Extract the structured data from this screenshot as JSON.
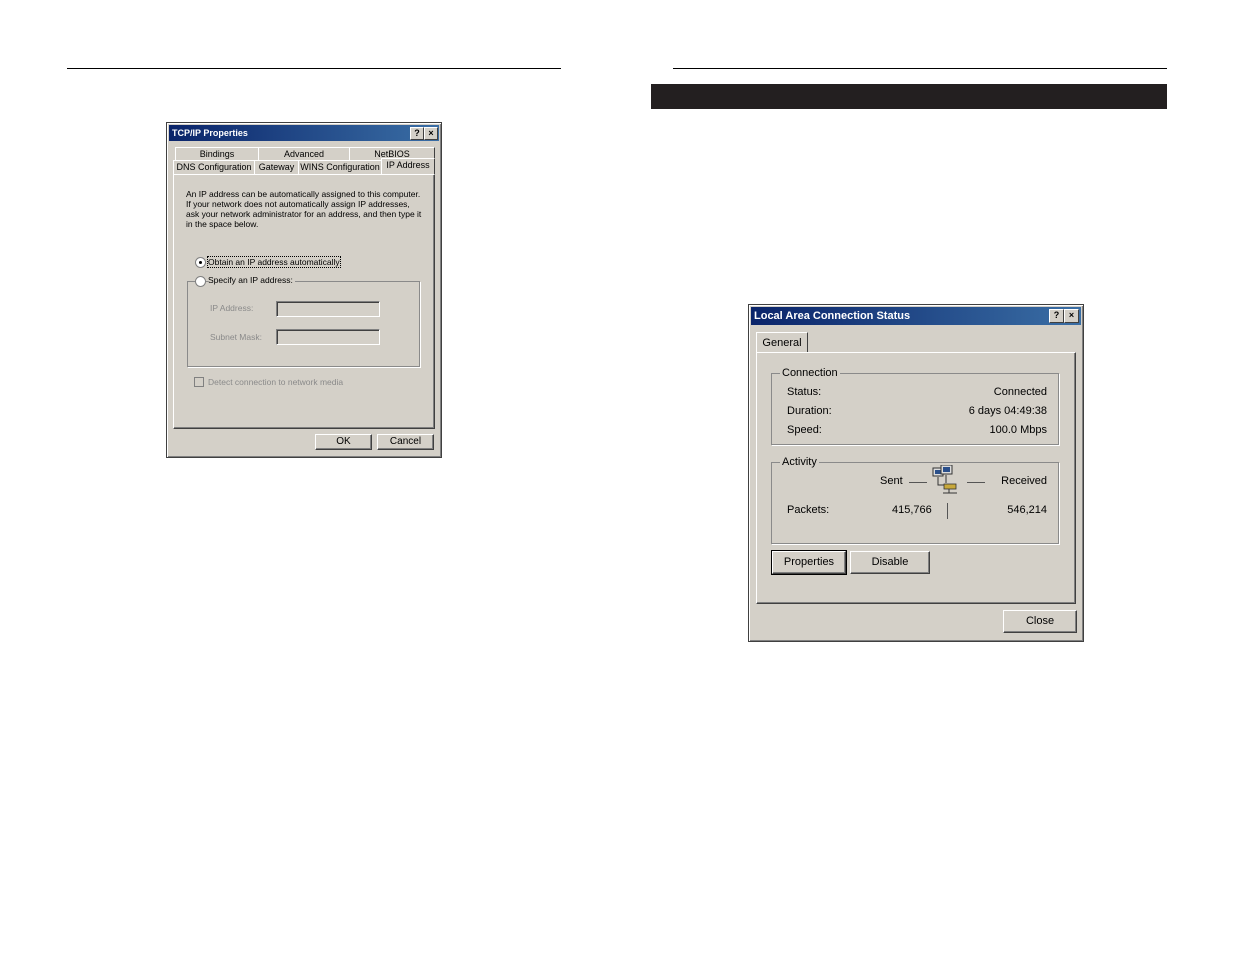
{
  "tcpip_dialog": {
    "title": "TCP/IP Properties",
    "help_btn": "?",
    "close_btn": "×",
    "tabs_row1": [
      "Bindings",
      "Advanced",
      "NetBIOS"
    ],
    "tabs_row2": [
      "DNS Configuration",
      "Gateway",
      "WINS Configuration",
      "IP Address"
    ],
    "description": "An IP address can be automatically assigned to this computer. If your network does not automatically assign IP addresses, ask your network administrator for an address, and then type it in the space below.",
    "option_auto": "Obtain an IP address automatically",
    "option_specify": "Specify an IP address:",
    "ip_label": "IP Address:",
    "subnet_label": "Subnet Mask:",
    "detect_label": "Detect connection to network media",
    "ok": "OK",
    "cancel": "Cancel"
  },
  "status_dialog": {
    "title": "Local Area Connection Status",
    "help_btn": "?",
    "close_btn": "×",
    "tab": "General",
    "connection_group": "Connection",
    "status_label": "Status:",
    "status_value": "Connected",
    "duration_label": "Duration:",
    "duration_value": "6 days 04:49:38",
    "speed_label": "Speed:",
    "speed_value": "100.0 Mbps",
    "activity_group": "Activity",
    "sent_label": "Sent",
    "received_label": "Received",
    "packets_label": "Packets:",
    "packets_sent": "415,766",
    "packets_received": "546,214",
    "properties": "Properties",
    "disable": "Disable",
    "close": "Close"
  }
}
